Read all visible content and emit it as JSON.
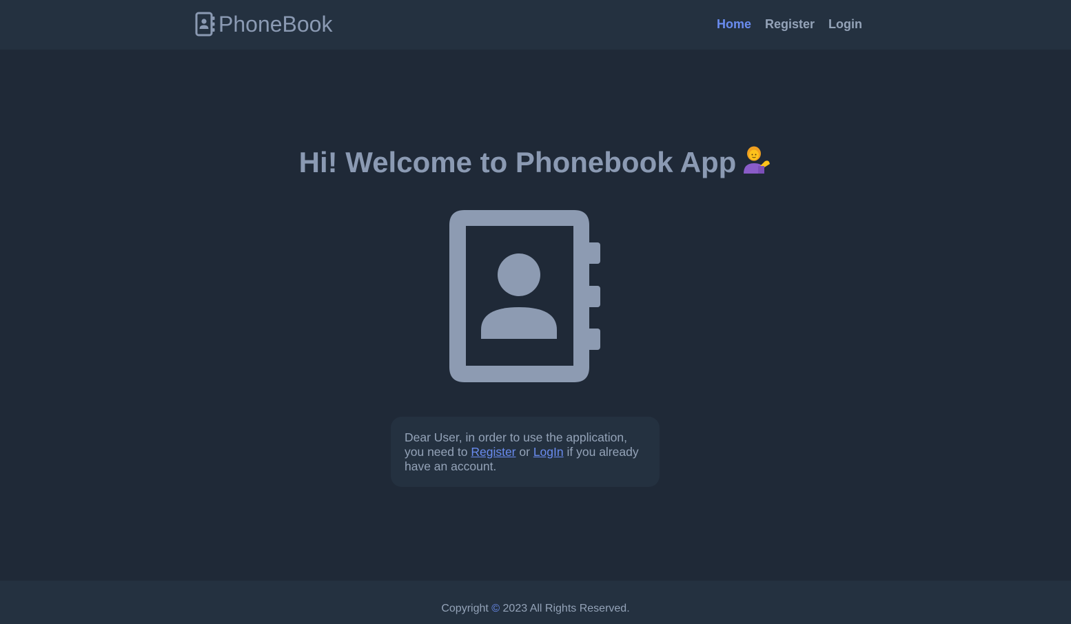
{
  "header": {
    "brand_name": "PhoneBook",
    "brand_icon": "address-book-icon",
    "nav": {
      "home": "Home",
      "register": "Register",
      "login": "Login"
    }
  },
  "main": {
    "welcome_text": "Hi! Welcome to Phonebook App",
    "welcome_emoji": "person-tipping-hand-icon",
    "hero_icon": "address-book-icon",
    "notice": {
      "text_before": "Dear User, in order to use the application, you need to",
      "register_link": "Register",
      "text_middle": "or",
      "login_link": "LogIn",
      "text_after": "if you already have an account."
    }
  },
  "footer": {
    "copyright_before": "Copyright",
    "copyright_symbol": "©",
    "copyright_after": "2023 All Rights Reserved."
  },
  "colors": {
    "background": "#1f2937",
    "header_bg": "#243140",
    "text": "#94a3b8",
    "accent": "#6a8cf0",
    "icon": "#8b9ab3"
  }
}
